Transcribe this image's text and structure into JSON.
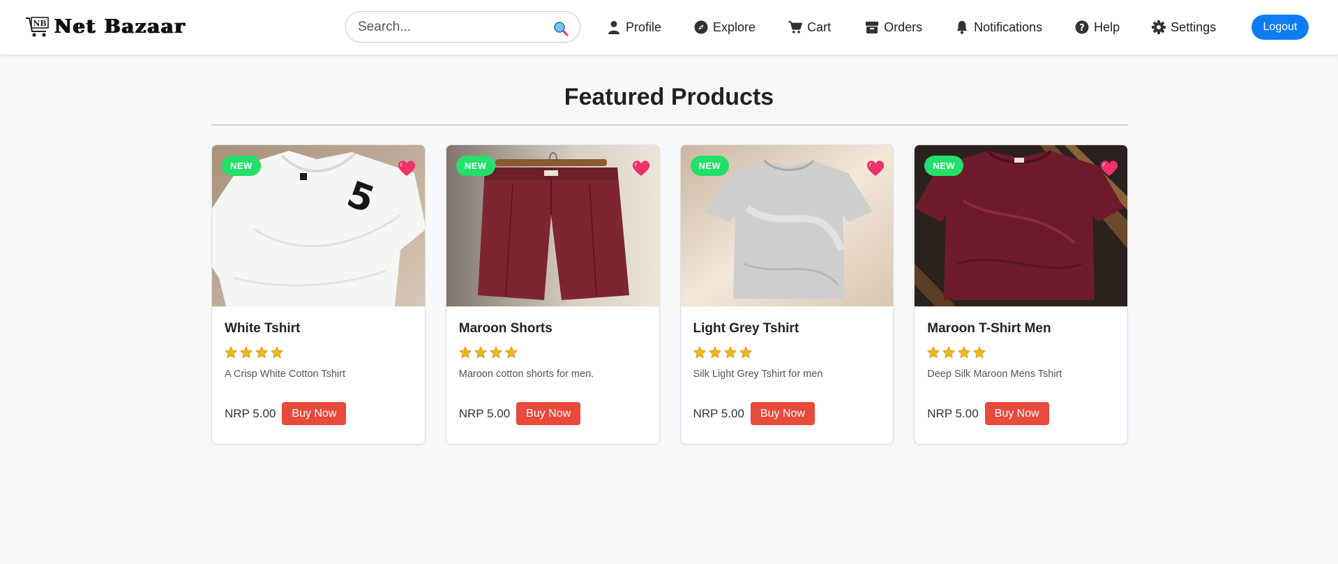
{
  "header": {
    "brand": "Net Bazaar",
    "logo_text": "NB",
    "search": {
      "placeholder": "Search...",
      "value": ""
    },
    "nav": [
      {
        "label": "Profile",
        "icon": "user-icon"
      },
      {
        "label": "Explore",
        "icon": "compass-icon"
      },
      {
        "label": "Cart",
        "icon": "cart-icon"
      },
      {
        "label": "Orders",
        "icon": "box-icon"
      },
      {
        "label": "Notifications",
        "icon": "bell-icon"
      },
      {
        "label": "Help",
        "icon": "question-icon"
      },
      {
        "label": "Settings",
        "icon": "gear-icon"
      }
    ],
    "logout_label": "Logout"
  },
  "main": {
    "title": "Featured Products",
    "products": [
      {
        "name": "White Tshirt",
        "badge": "NEW",
        "rating": 4,
        "description": "A Crisp White Cotton Tshirt",
        "price": "NRP 5.00",
        "buy_label": "Buy Now",
        "image": "white-tshirt"
      },
      {
        "name": "Maroon Shorts",
        "badge": "NEW",
        "rating": 4,
        "description": "Maroon cotton shorts for men.",
        "price": "NRP 5.00",
        "buy_label": "Buy Now",
        "image": "maroon-shorts"
      },
      {
        "name": "Light Grey Tshirt",
        "badge": "NEW",
        "rating": 4,
        "description": "Silk Light Grey Tshirt for men",
        "price": "NRP 5.00",
        "buy_label": "Buy Now",
        "image": "light-grey-tshirt"
      },
      {
        "name": "Maroon T-Shirt Men",
        "badge": "NEW",
        "rating": 4,
        "description": "Deep Silk Maroon Mens Tshirt",
        "price": "NRP 5.00",
        "buy_label": "Buy Now",
        "image": "maroon-tshirt"
      }
    ]
  },
  "colors": {
    "accent_blue": "#0d7df1",
    "buy_red": "#e84a3c",
    "badge_green": "#22e06a",
    "heart_pink": "#f0306a",
    "star_gold": "#f2b61c"
  }
}
